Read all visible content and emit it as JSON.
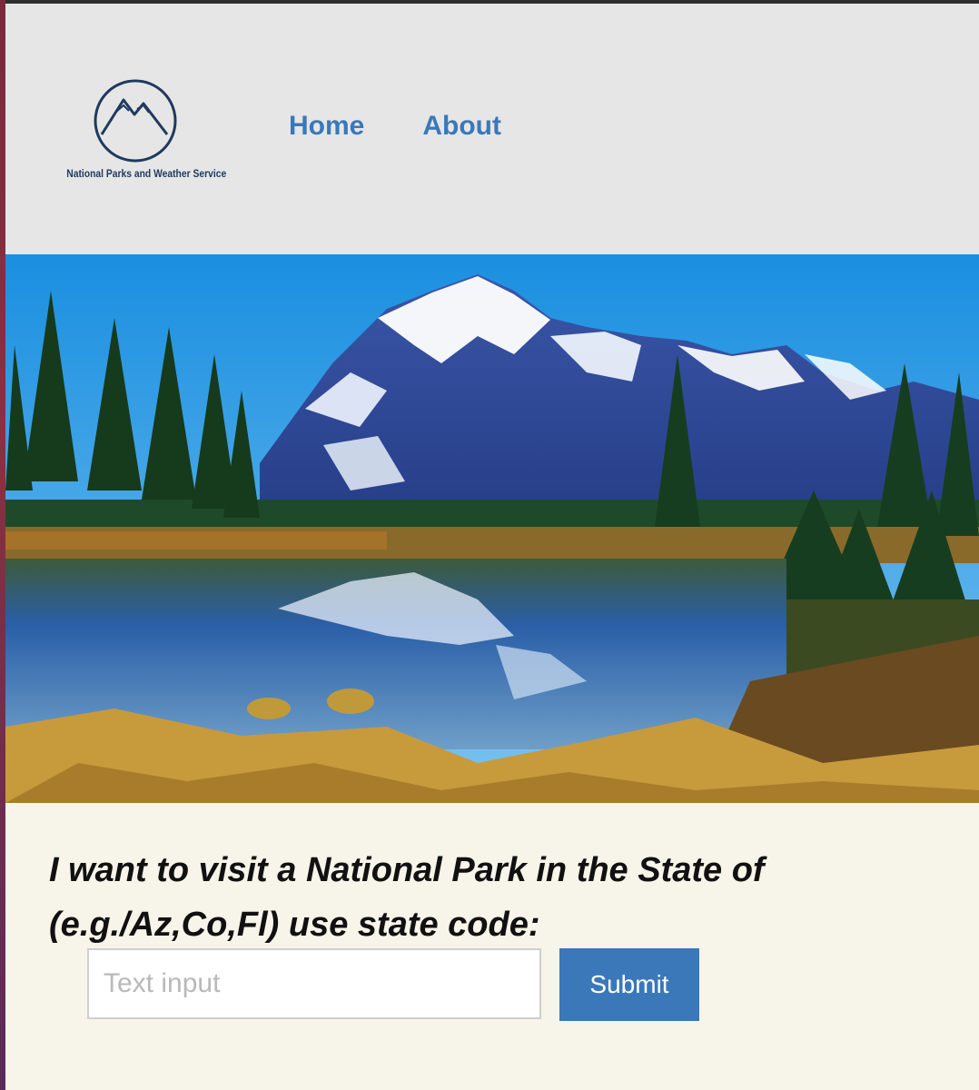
{
  "header": {
    "logo_text": "National Parks and Weather Service",
    "nav": [
      {
        "label": "Home"
      },
      {
        "label": "About"
      }
    ]
  },
  "hero": {
    "icon": "mountain-lake-landscape-image"
  },
  "search": {
    "prompt_line1": "I want to visit a National Park in the State of",
    "prompt_line2": "(e.g./Az,Co,Fl) use state code:",
    "placeholder": "Text input",
    "submit_label": "Submit"
  },
  "colors": {
    "header_bg": "#e6e6e6",
    "page_bg": "#f7f4e9",
    "accent": "#3a78b9",
    "logo": "#1f3a5f"
  }
}
